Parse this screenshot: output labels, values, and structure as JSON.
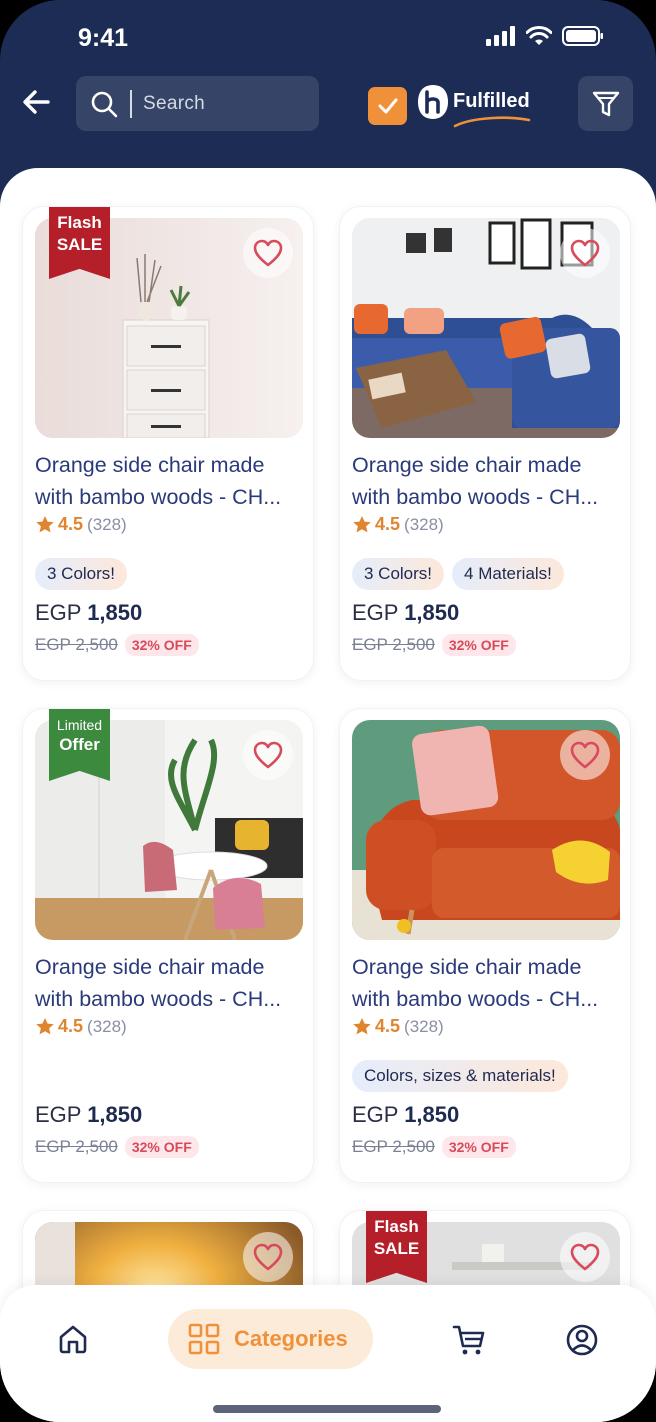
{
  "status_bar": {
    "time": "9:41"
  },
  "header": {
    "search_placeholder": "Search",
    "fulfilled_label": "Fulfilled",
    "fulfilled_checked": true,
    "accent": "#f0913a",
    "bg": "#1c2c55"
  },
  "products": [
    {
      "title_line1": "Orange side chair made",
      "title_line2": "with bambo woods - CH...",
      "rating": "4.5",
      "reviews": "(328)",
      "chips": [
        "3 Colors!"
      ],
      "price_currency": "EGP",
      "price": "1,850",
      "old_price": "EGP 2,500",
      "discount": "32% OFF",
      "ribbon": {
        "line1": "Flash",
        "line2": "SALE",
        "color": "red"
      }
    },
    {
      "title_line1": "Orange side chair made",
      "title_line2": "with bambo woods - CH...",
      "rating": "4.5",
      "reviews": "(328)",
      "chips": [
        "3 Colors!",
        "4 Materials!"
      ],
      "price_currency": "EGP",
      "price": "1,850",
      "old_price": "EGP 2,500",
      "discount": "32% OFF"
    },
    {
      "title_line1": "Orange side chair made",
      "title_line2": "with bambo woods - CH...",
      "rating": "4.5",
      "reviews": "(328)",
      "chips": [],
      "price_currency": "EGP",
      "price": "1,850",
      "old_price": "EGP 2,500",
      "discount": "32% OFF",
      "ribbon": {
        "line1": "Limited",
        "line2": "Offer",
        "color": "green"
      }
    },
    {
      "title_line1": "Orange side chair made",
      "title_line2": "with bambo woods - CH...",
      "rating": "4.5",
      "reviews": "(328)",
      "chips": [
        "Colors, sizes & materials!"
      ],
      "price_currency": "EGP",
      "price": "1,850",
      "old_price": "EGP 2,500",
      "discount": "32% OFF"
    },
    {
      "ribbon": null
    },
    {
      "ribbon": {
        "line1": "Flash",
        "line2": "SALE",
        "color": "red"
      }
    }
  ],
  "bottom_nav": {
    "items": [
      {
        "icon": "home-icon"
      },
      {
        "icon": "categories-icon",
        "label": "Categories",
        "active": true
      },
      {
        "icon": "cart-icon"
      },
      {
        "icon": "profile-icon"
      }
    ]
  }
}
